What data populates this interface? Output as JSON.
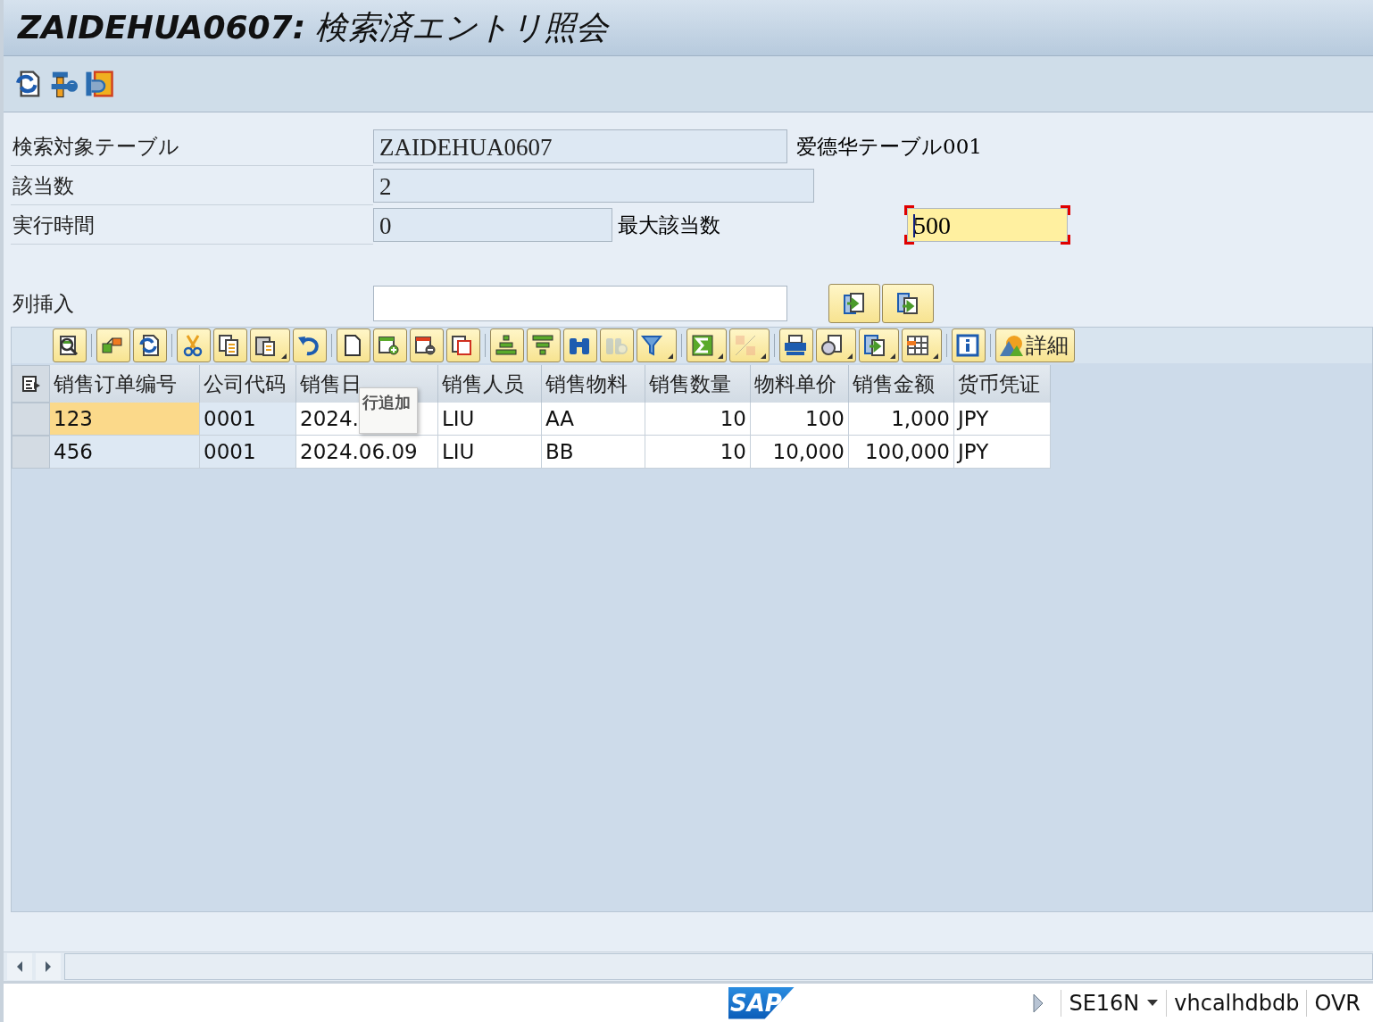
{
  "window": {
    "title": "**ZAIDEHUA0607:** 検索済エントリ照会"
  },
  "app_toolbar": {
    "buttons": [
      {
        "kind": "refresh"
      },
      {
        "kind": "tools"
      },
      {
        "kind": "stamp"
      }
    ]
  },
  "form": {
    "rows": [
      {
        "label": "検索対象テーブル",
        "value": "ZAIDEHUA0607",
        "note": "爱德华テーブル001"
      },
      {
        "label": "該当数",
        "value": "2"
      },
      {
        "label": "実行時間",
        "value": "0",
        "extra_label": "最大該当数",
        "extra_value": "500",
        "extra_focused": true
      }
    ],
    "column_insert": {
      "label": "列挿入",
      "buttons": [
        {
          "kind": "import"
        },
        {
          "kind": "export"
        }
      ]
    }
  },
  "grid_toolbar": {
    "groups": [
      [
        {
          "kind": "details",
          "dropdown": false,
          "disabled": false
        }
      ],
      [
        {
          "kind": "objects",
          "dropdown": false,
          "disabled": false
        },
        {
          "kind": "refresh",
          "dropdown": false,
          "disabled": false
        }
      ],
      [
        {
          "kind": "cut",
          "dropdown": false,
          "disabled": false
        },
        {
          "kind": "copy",
          "dropdown": false,
          "disabled": false
        },
        {
          "kind": "paste",
          "dropdown": true,
          "disabled": false
        },
        {
          "kind": "undo",
          "dropdown": false,
          "disabled": false
        }
      ],
      [
        {
          "kind": "page",
          "dropdown": false,
          "disabled": false
        },
        {
          "kind": "addrow",
          "dropdown": false,
          "disabled": false
        },
        {
          "kind": "delrow",
          "dropdown": false,
          "disabled": false
        },
        {
          "kind": "copyrow",
          "dropdown": false,
          "disabled": false
        }
      ],
      [
        {
          "kind": "sortup",
          "dropdown": false,
          "disabled": false
        },
        {
          "kind": "sortdown",
          "dropdown": false,
          "disabled": false
        },
        {
          "kind": "find",
          "dropdown": false,
          "disabled": false
        },
        {
          "kind": "findnext",
          "dropdown": false,
          "disabled": true
        },
        {
          "kind": "filter",
          "dropdown": true,
          "disabled": false
        }
      ],
      [
        {
          "kind": "sum",
          "dropdown": true,
          "disabled": false
        },
        {
          "kind": "subtotal",
          "dropdown": true,
          "disabled": true
        }
      ],
      [
        {
          "kind": "print",
          "dropdown": false,
          "disabled": false
        },
        {
          "kind": "views",
          "dropdown": true,
          "disabled": false
        },
        {
          "kind": "exportdoc",
          "dropdown": true,
          "disabled": false
        },
        {
          "kind": "layout",
          "dropdown": true,
          "disabled": false
        }
      ],
      [
        {
          "kind": "info",
          "dropdown": false,
          "disabled": false
        }
      ],
      [
        {
          "kind": "mountain",
          "dropdown": false,
          "disabled": false,
          "label": "詳細"
        }
      ]
    ]
  },
  "table": {
    "columns": [
      "销售订单编号",
      "公司代码",
      "销售日",
      "销售人员",
      "销售物料",
      "销售数量",
      "物料单价",
      "销售金额",
      "货币凭证"
    ],
    "rows": [
      {
        "cells": [
          {
            "text": "123",
            "selected": true
          },
          {
            "text": "0001",
            "selected": false
          },
          {
            "text": "2024.",
            "selected": false
          },
          {
            "text": "LIU",
            "selected": false
          },
          {
            "text": "AA",
            "selected": false
          },
          {
            "text": "10",
            "selected": false
          },
          {
            "text": "100",
            "selected": false
          },
          {
            "text": "1,000",
            "selected": false
          },
          {
            "text": "JPY",
            "selected": false
          }
        ]
      },
      {
        "cells": [
          {
            "text": "456",
            "selected": false
          },
          {
            "text": "0001",
            "selected": false
          },
          {
            "text": "2024.06.09",
            "selected": false
          },
          {
            "text": "LIU",
            "selected": false
          },
          {
            "text": "BB",
            "selected": false
          },
          {
            "text": "10",
            "selected": false
          },
          {
            "text": "10,000",
            "selected": false
          },
          {
            "text": "100,000",
            "selected": false
          },
          {
            "text": "JPY",
            "selected": false
          }
        ]
      }
    ],
    "tooltip": "行追加"
  },
  "status_bar": {
    "logo": "SAP",
    "transaction": "SE16N",
    "system": "vhcalhdbdb",
    "mode": "OVR"
  }
}
